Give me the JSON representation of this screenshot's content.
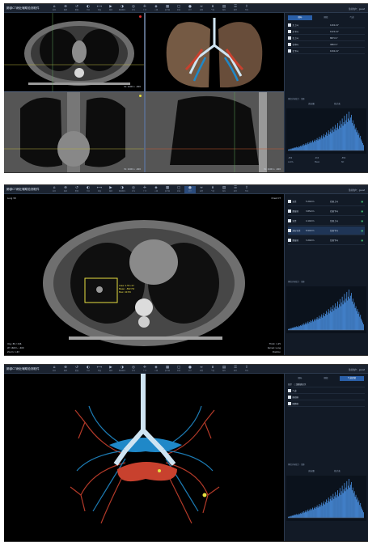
{
  "app": {
    "title": "肺部CT病灶辅助检测软件",
    "user": "当前用户：guest"
  },
  "toolbar": [
    {
      "icon": "home",
      "label": "首页"
    },
    {
      "icon": "zoom",
      "label": "缩放"
    },
    {
      "icon": "reset",
      "label": "重置"
    },
    {
      "icon": "visible",
      "label": "可见"
    },
    {
      "icon": "measure",
      "label": "测量"
    },
    {
      "icon": "play",
      "label": "播放"
    },
    {
      "icon": "wl",
      "label": "窗宽窗位"
    },
    {
      "icon": "locate",
      "label": "定位"
    },
    {
      "icon": "cross",
      "label": "十字"
    },
    {
      "icon": "vr",
      "label": "三维"
    },
    {
      "icon": "mpr",
      "label": "多平面"
    },
    {
      "icon": "roi",
      "label": "区域"
    },
    {
      "icon": "nodule",
      "label": "结节"
    },
    {
      "icon": "vessel",
      "label": "血管"
    },
    {
      "icon": "airway",
      "label": "气道"
    },
    {
      "icon": "save",
      "label": "保存"
    },
    {
      "icon": "report",
      "label": "报告"
    },
    {
      "icon": "export",
      "label": "导出"
    }
  ],
  "s1": {
    "tabs": [
      "肺叶",
      "肺段",
      "气道"
    ],
    "rows": [
      {
        "name": "左上叶",
        "value": "1401cm³"
      },
      {
        "name": "左下叶",
        "value": "1021cm³"
      },
      {
        "name": "右上叶",
        "value": "887cm³"
      },
      {
        "name": "右中叶",
        "value": "466cm³"
      },
      {
        "name": "右下叶",
        "value": "1091cm³"
      }
    ],
    "hist_title": "体积分布统计 · 全肺",
    "hist_tabs": [
      "直方图",
      "统计表"
    ],
    "axial_info": "W: 1600 L: -600",
    "coronal_info": "W: 1600 L: -600",
    "sag_info": "W: 1600 L: -600",
    "stats": [
      "-950",
      "-910",
      "-856",
      "LAA%",
      "Mean",
      "SD"
    ]
  },
  "s2": {
    "top_info": [
      "Lung 3D",
      "Chest CT"
    ],
    "measure": [
      "Area: 1.55 cm²",
      "Mean: -582 HU",
      "Max: 40 HU"
    ],
    "bot_left": [
      "Img: 89 / 246",
      "W: 1600 L: -600",
      "Zoom: 1.63"
    ],
    "bot_right": [
      "Thick: 1.25",
      "Kernel: Lung",
      "Position"
    ],
    "nodules": [
      {
        "type": "实性",
        "size": "5.20mm",
        "loc": "右肺上叶"
      },
      {
        "type": "磨玻璃",
        "size": "3.85mm",
        "loc": "右肺下叶"
      },
      {
        "type": "实性",
        "size": "4.10mm",
        "loc": "左肺上叶"
      },
      {
        "type": "部分实性",
        "size": "8.90mm",
        "loc": "左肺下叶"
      },
      {
        "type": "磨玻璃",
        "size": "3.20mm",
        "loc": "左肺下叶"
      }
    ],
    "hist_title": "体积分布统计 · 全肺"
  },
  "s3": {
    "tabs": [
      "肺叶",
      "肺段",
      "气道血管"
    ],
    "header": "显示 · 三维重建显示",
    "layers": [
      "气道",
      "肺动脉",
      "肺静脉"
    ],
    "hist_title": "体积分布统计 · 全肺",
    "hist_tabs": [
      "直方图",
      "统计表"
    ]
  },
  "hist": [
    2,
    3,
    2,
    4,
    3,
    5,
    4,
    6,
    5,
    7,
    6,
    8,
    7,
    6,
    9,
    8,
    10,
    9,
    12,
    10,
    14,
    11,
    13,
    16,
    12,
    15,
    18,
    14,
    17,
    20,
    16,
    19,
    22,
    18,
    21,
    24,
    20,
    23,
    27,
    22,
    25,
    30,
    24,
    28,
    33,
    26,
    31,
    36,
    29,
    34,
    40,
    32,
    37,
    44,
    35,
    41,
    48,
    38,
    44,
    52,
    41,
    47,
    56,
    44,
    50,
    60,
    47,
    54,
    65,
    50,
    58,
    70,
    54,
    62,
    76,
    58,
    66,
    80,
    62,
    70,
    85,
    66,
    72,
    78,
    60,
    66,
    54,
    58,
    46,
    50,
    40,
    44,
    34,
    38,
    28,
    32,
    24,
    20,
    16,
    12
  ],
  "colors": {
    "airway": "#cfe4f2",
    "artery": "#1f88c8",
    "vein": "#c8412e",
    "accent": "#2a5fa8",
    "hist": "#4a90e2"
  }
}
